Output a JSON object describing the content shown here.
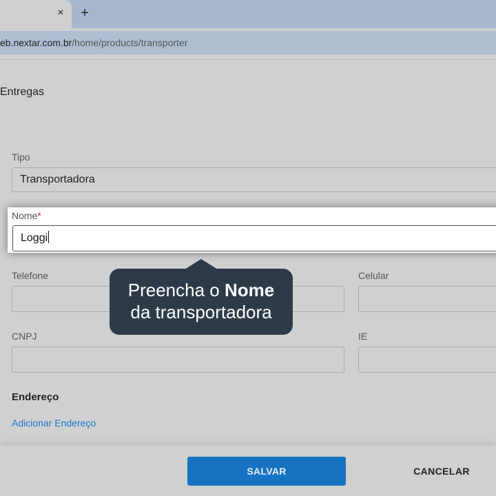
{
  "browser": {
    "tab_close": "×",
    "new_tab": "+",
    "url_host": "eb.nextar.com.br",
    "url_path": "/home/products/transporter"
  },
  "page": {
    "title": "Entregas"
  },
  "form": {
    "tipo_label": "Tipo",
    "tipo_value": "Transportadora",
    "nome_label": "Nome",
    "nome_required": "*",
    "nome_value": "Loggi",
    "telefone_label": "Telefone",
    "celular_label": "Celular",
    "cnpj_label": "CNPJ",
    "ie_label": "IE",
    "endereco_title": "Endereço",
    "add_endereco": "Adicionar Endereço"
  },
  "tooltip": {
    "line1_prefix": "Preencha o ",
    "line1_bold": "Nome",
    "line2": "da transportadora"
  },
  "footer": {
    "save_label": "SALVAR",
    "cancel_label": "CANCELAR"
  },
  "colors": {
    "accent": "#1773c2",
    "tooltip_bg": "#2d3b49",
    "link": "#1976d2",
    "required": "#d32f2f"
  }
}
